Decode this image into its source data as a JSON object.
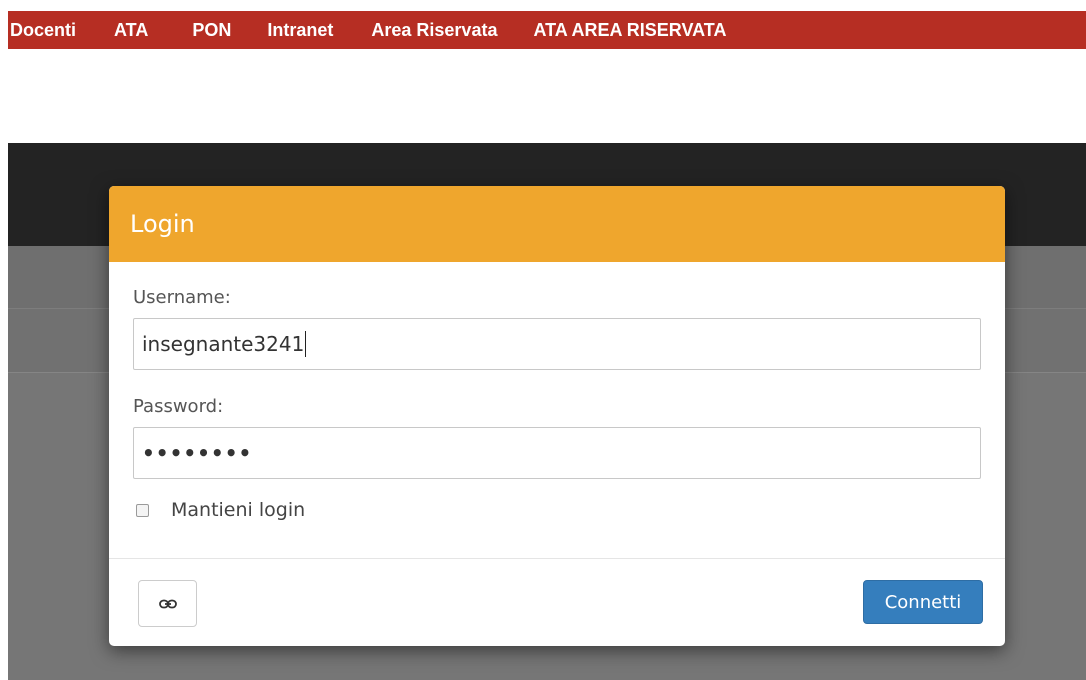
{
  "nav": {
    "items": [
      {
        "label": "Docenti"
      },
      {
        "label": "ATA"
      },
      {
        "label": "PON"
      },
      {
        "label": "Intranet"
      },
      {
        "label": "Area Riservata"
      },
      {
        "label": "ATA AREA RISERVATA"
      }
    ],
    "background": "#b62e23"
  },
  "modal": {
    "title": "Login",
    "header_color": "#efa62d",
    "username": {
      "label": "Username:",
      "value": "insegnante3241"
    },
    "password": {
      "label": "Password:",
      "value_masked": "••••••••"
    },
    "remember": {
      "label": "Mantieni login",
      "checked": false
    },
    "footer": {
      "link_icon": "link-icon",
      "connect_label": "Connetti",
      "connect_color": "#357ebd"
    }
  }
}
